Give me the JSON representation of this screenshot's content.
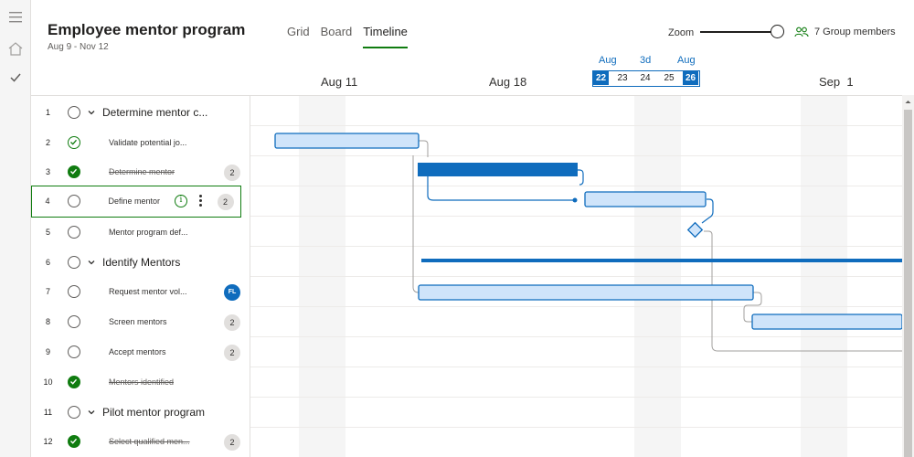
{
  "header": {
    "title": "Employee mentor program",
    "date_range": "Aug 9 - Nov 12",
    "tabs": [
      {
        "label": "Grid",
        "active": false
      },
      {
        "label": "Board",
        "active": false
      },
      {
        "label": "Timeline",
        "active": true
      }
    ],
    "zoom_label": "Zoom",
    "zoom_level": 1.0,
    "members_label": "7 Group members"
  },
  "timeline": {
    "date_labels": [
      "Aug 11",
      "Aug 18",
      "Sep  1"
    ],
    "range_picker": {
      "start_month": "Aug",
      "duration": "3d",
      "end_month": "Aug",
      "days": [
        "22",
        "23",
        "24",
        "25",
        "26"
      ]
    }
  },
  "tasks": [
    {
      "num": "1",
      "label": "Determine mentor c...",
      "type": "group",
      "status": "open"
    },
    {
      "num": "2",
      "label": "Validate potential jo...",
      "type": "task",
      "status": "in-progress"
    },
    {
      "num": "3",
      "label": "Determine mentor",
      "type": "task",
      "status": "done",
      "badge": "2"
    },
    {
      "num": "4",
      "label": "Define mentor",
      "type": "task",
      "status": "open",
      "badge": "2",
      "selected": true
    },
    {
      "num": "5",
      "label": "Mentor program def...",
      "type": "task",
      "status": "open"
    },
    {
      "num": "6",
      "label": "Identify Mentors",
      "type": "group",
      "status": "open"
    },
    {
      "num": "7",
      "label": "Request mentor vol...",
      "type": "task",
      "status": "open",
      "avatar": "FL"
    },
    {
      "num": "8",
      "label": "Screen mentors",
      "type": "task",
      "status": "open",
      "badge": "2"
    },
    {
      "num": "9",
      "label": "Accept mentors",
      "type": "task",
      "status": "open",
      "badge": "2"
    },
    {
      "num": "10",
      "label": "Mentors identified",
      "type": "task",
      "status": "done"
    },
    {
      "num": "11",
      "label": "Pilot mentor  program",
      "type": "group",
      "status": "open"
    },
    {
      "num": "12",
      "label": "Select qualified men...",
      "type": "task",
      "status": "done",
      "badge": "2"
    }
  ],
  "colors": {
    "accent": "#0f6cbd",
    "bar_fill": "#cfe4fa",
    "success": "#107c10"
  }
}
